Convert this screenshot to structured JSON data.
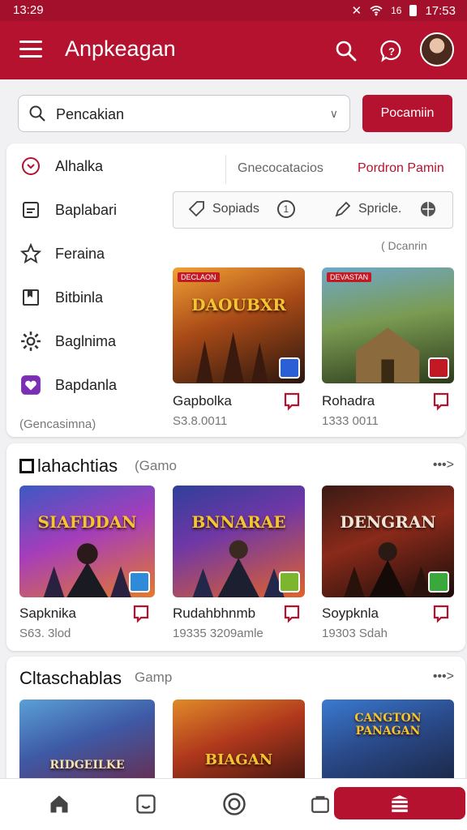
{
  "status": {
    "time_left": "13:29",
    "time_right": "17:53",
    "signal": "16"
  },
  "appbar": {
    "title": "Anpkeagan"
  },
  "search": {
    "value": "Pencakian",
    "button": "Pocamiin"
  },
  "sidebar": {
    "items": [
      {
        "label": "Alhalka",
        "icon": "target-icon"
      },
      {
        "label": "Baplabari",
        "icon": "list-icon"
      },
      {
        "label": "Feraina",
        "icon": "star-icon"
      },
      {
        "label": "Bitbinla",
        "icon": "bookmark-book-icon"
      },
      {
        "label": "Baglnima",
        "icon": "gear-icon"
      },
      {
        "label": "Bapdanla",
        "icon": "heart-icon"
      }
    ],
    "footer": "(Gencasimna)"
  },
  "tabs": [
    "Gnecocatacios",
    "Pordron Pamin"
  ],
  "chips": [
    {
      "label": "Sopiads",
      "badge": "1"
    },
    {
      "label": "Spricle."
    }
  ],
  "hint": "( Dcanrin",
  "featured": [
    {
      "title": "DAOUBXR",
      "tag": "DECLAON",
      "name": "Gapbolka",
      "meta": "S3.8.0011"
    },
    {
      "title": "",
      "tag": "DEVASTAN",
      "name": "Rohadra",
      "meta": "1333 0011"
    }
  ],
  "section1": {
    "title": "lahachtias",
    "subtitle": "(Gamo",
    "more": "•••>",
    "games": [
      {
        "title": "SIAFDDAN",
        "name": "Sapknika",
        "meta": "S63. 3lod"
      },
      {
        "title": "BNNARAE",
        "name": "Rudahbhnmb",
        "meta": "19335 3209amle"
      },
      {
        "title": "DENGRAN",
        "name": "Soypknla",
        "meta": "19303 Sdah"
      }
    ]
  },
  "section2": {
    "title": "Cltaschablas",
    "subtitle": "Gamp",
    "more": "•••>",
    "games": [
      {
        "title": "RIDGEILKE"
      },
      {
        "title": "BIAGAN"
      },
      {
        "title": "CANGTON PANAGAN"
      }
    ]
  },
  "colors": {
    "brand": "#b5122f",
    "accent_text": "#b5122f"
  }
}
